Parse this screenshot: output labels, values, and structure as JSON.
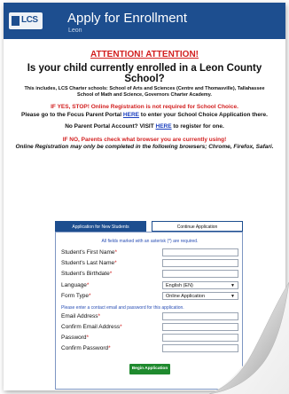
{
  "header": {
    "logo_text": "LCS",
    "title": "Apply for Enrollment",
    "subtitle": "Leon"
  },
  "notice": {
    "attention": "ATTENTION! ATTENTION!",
    "question": "Is your child currently enrolled in a Leon County School?",
    "includes": "This includes, LCS Charter schools: School of Arts and Sciences (Centre and Thomasville), Tallahassee School of Math and Science, Governors Charter Academy.",
    "if_yes": "IF YES, STOP! Online Registration is not required for School Choice.",
    "goto_prefix": "Please go to the Focus Parent Portal ",
    "goto_link": "HERE",
    "goto_suffix": " to enter your School Choice Application there.",
    "no_portal_prefix": "No Parent Portal Account?  VISIT ",
    "no_portal_link": "HERE",
    "no_portal_suffix": " to register for one.",
    "if_no": "IF NO, Parents check what browser you are currently using!",
    "browsers": "Online Registration may only be completed in the following browsers; Chrome, Firefox, Safari."
  },
  "tabs": {
    "new_students": "Application for New Students",
    "continue": "Continue Application"
  },
  "form": {
    "required_note": "All fields marked with an asterisk (*) are required.",
    "first_name_label": "Student's First Name",
    "last_name_label": "Student's Last Name",
    "birthdate_label": "Student's Birthdate",
    "language_label": "Language",
    "language_value": "English (EN)",
    "form_type_label": "Form Type",
    "form_type_value": "Online Application",
    "contact_note": "Please enter a contact email and password for this application.",
    "email_label": "Email Address",
    "confirm_email_label": "Confirm Email Address",
    "password_label": "Password",
    "confirm_password_label": "Confirm Password",
    "asterisk": "*"
  },
  "begin_button": "Begin Application",
  "colors": {
    "header_bg": "#1d4e8f",
    "alert_red": "#d21f1f",
    "link_blue": "#1a3fbf",
    "button_green": "#1f8a2e"
  }
}
